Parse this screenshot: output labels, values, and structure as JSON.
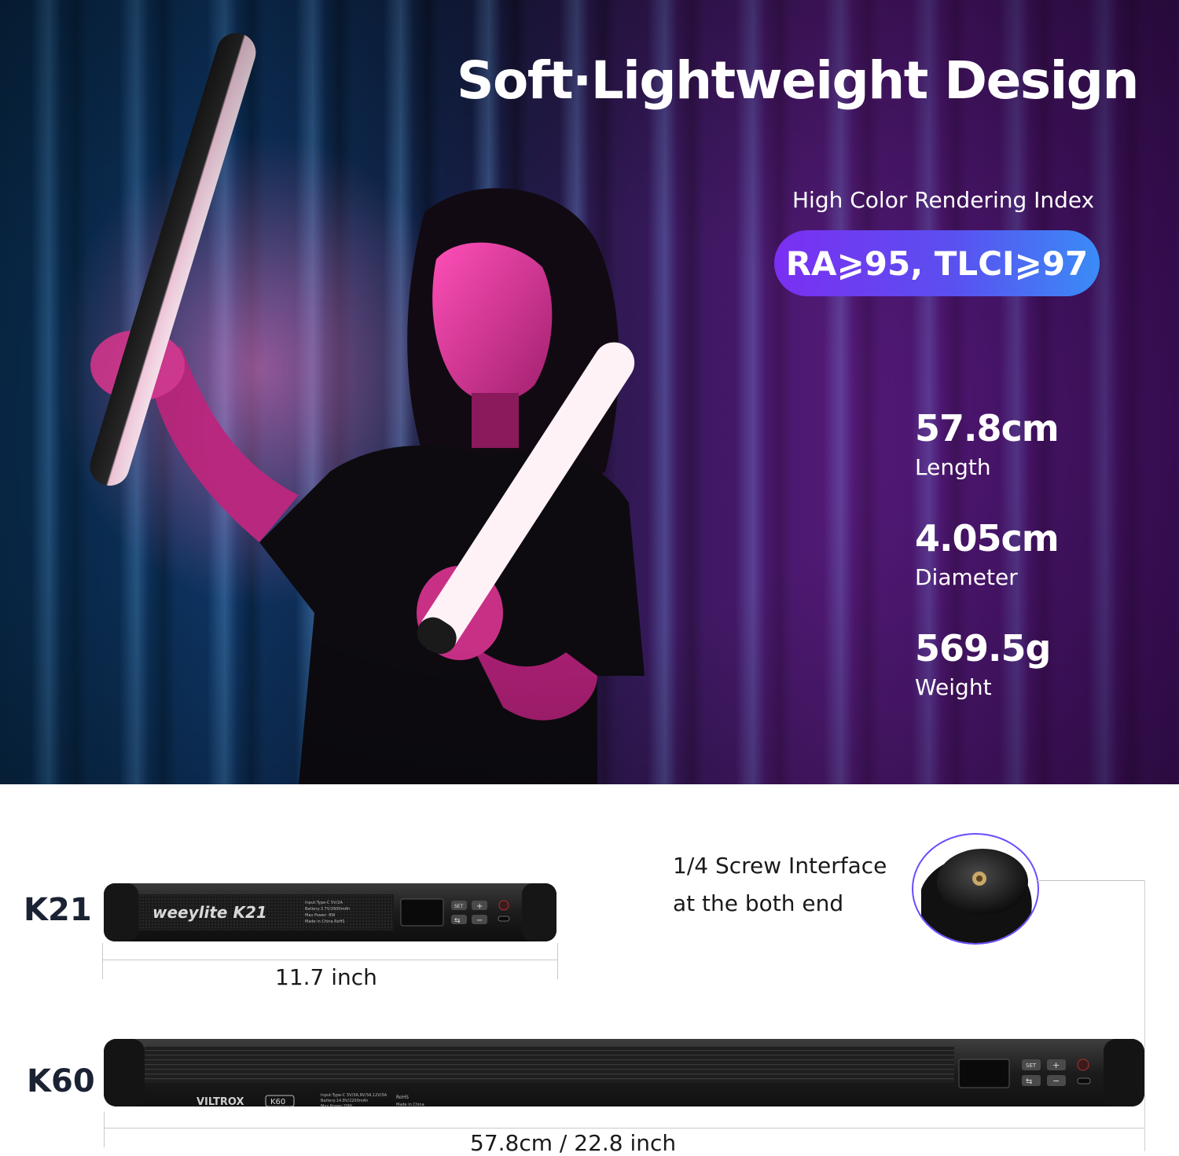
{
  "hero": {
    "title": "Soft·Lightweight Design",
    "cri_label": "High Color Rendering Index",
    "cri_value": "RA⩾95, TLCI⩾97",
    "specs": [
      {
        "value": "57.8cm",
        "label": "Length"
      },
      {
        "value": "4.05cm",
        "label": "Diameter"
      },
      {
        "value": "569.5g",
        "label": "Weight"
      }
    ]
  },
  "products": {
    "k21": {
      "label": "K21",
      "brand": "weeylite K21",
      "dimension": "11.7 inch",
      "fine_print": [
        "Input:Type-C 5V/2A",
        "Battery:3.7V/2600mAh",
        "Max Power: 8W",
        "Made in China  RoHS"
      ]
    },
    "k60": {
      "label": "K60",
      "brand": "VILTROX",
      "model_badge": "K60",
      "dimension": "57.8cm / 22.8 inch",
      "fine_print": [
        "Input:Type-C 5V/3A,9V/3A,12V/3A",
        "Battery:14.8V/2200mAh",
        "Max Power:20W",
        "RoHS",
        "Made in China"
      ]
    },
    "buttons": {
      "set": "SET",
      "plus": "+",
      "minus": "−",
      "swap": "⇆"
    }
  },
  "screw": {
    "line1": "1/4 Screw Interface",
    "line2": "at the both end"
  },
  "colors": {
    "pill_start": "#7b2ff2",
    "pill_end": "#3a8cf7",
    "text_dark": "#1a2233"
  }
}
